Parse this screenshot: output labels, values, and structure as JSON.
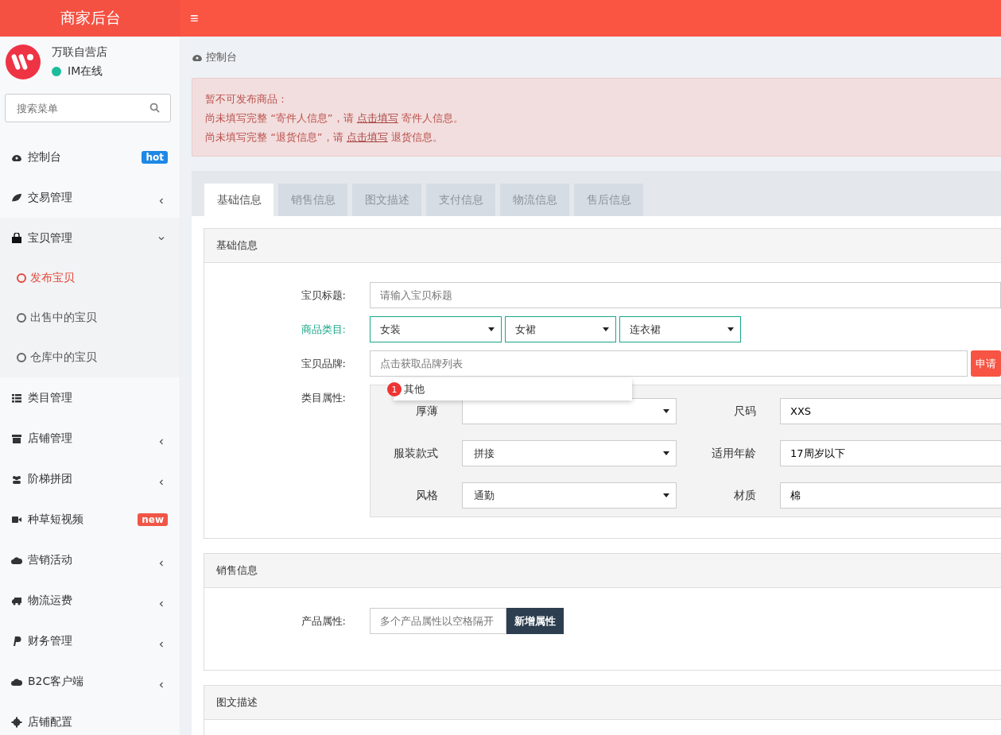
{
  "app": {
    "title": "商家后台",
    "menu_icon": "≡"
  },
  "sidebar": {
    "store_name": "万联自营店",
    "status": "IM在线",
    "search": {
      "placeholder": "搜索菜单"
    },
    "items": [
      {
        "label": "控制台",
        "badge": {
          "text": "hot",
          "color": "#1e88e5"
        },
        "expandable": false
      },
      {
        "label": "交易管理",
        "expandable": true,
        "expanded": false
      },
      {
        "label": "宝贝管理",
        "expandable": true,
        "expanded": true,
        "children": [
          {
            "label": "发布宝贝",
            "selected": true
          },
          {
            "label": "出售中的宝贝",
            "selected": false
          },
          {
            "label": "仓库中的宝贝",
            "selected": false
          }
        ]
      },
      {
        "label": "类目管理",
        "expandable": false
      },
      {
        "label": "店铺管理",
        "expandable": true,
        "expanded": false
      },
      {
        "label": "阶梯拼团",
        "expandable": true,
        "expanded": false
      },
      {
        "label": "种草短视频",
        "badge": {
          "text": "new",
          "color": "#f05545"
        },
        "expandable": false
      },
      {
        "label": "营销活动",
        "expandable": true,
        "expanded": false
      },
      {
        "label": "物流运费",
        "expandable": true,
        "expanded": false
      },
      {
        "label": "财务管理",
        "expandable": true,
        "expanded": false
      },
      {
        "label": "B2C客户端",
        "expandable": true,
        "expanded": false
      },
      {
        "label": "店铺配置",
        "expandable": false
      }
    ]
  },
  "breadcrumb": "控制台",
  "alert": {
    "title": "暂不可发布商品：",
    "lines": [
      {
        "before": "尚未填写完整 “寄件人信息”，请",
        "link": "点击填写",
        "after": "寄件人信息。"
      },
      {
        "before": "尚未填写完整 “退货信息”，请",
        "link": "点击填写",
        "after": "退货信息。"
      }
    ]
  },
  "tabs": [
    {
      "label": "基础信息",
      "selected": true
    },
    {
      "label": "销售信息",
      "selected": false
    },
    {
      "label": "图文描述",
      "selected": false
    },
    {
      "label": "支付信息",
      "selected": false
    },
    {
      "label": "物流信息",
      "selected": false
    },
    {
      "label": "售后信息",
      "selected": false
    }
  ],
  "basic": {
    "title": "基础信息",
    "item_title": {
      "label": "宝贝标题:",
      "placeholder": "请输入宝贝标题"
    },
    "category": {
      "label": "商品类目:",
      "valid": true,
      "selects": [
        "女装",
        "女裙",
        "连衣裙"
      ]
    },
    "brand": {
      "label": "宝贝品牌:",
      "placeholder": "点击获取品牌列表",
      "button": "申请",
      "suggestions": [
        {
          "badge": "1",
          "text": "其他"
        }
      ]
    },
    "attributes": {
      "label": "类目属性:",
      "items": [
        {
          "kind": "select",
          "label": "厚薄"
        },
        {
          "kind": "input",
          "label": "尺码",
          "value": "XXS"
        },
        {
          "kind": "select",
          "label": "服装款式",
          "value": "拼接"
        },
        {
          "kind": "input",
          "label": "适用年龄",
          "value": "17周岁以下"
        },
        {
          "kind": "select",
          "label": "风格",
          "value": "通勤"
        },
        {
          "kind": "input",
          "label": "材质",
          "value": "棉"
        }
      ]
    }
  },
  "sales": {
    "title": "销售信息",
    "label": "产品属性:",
    "placeholder": "多个产品属性以空格隔开",
    "button": "新增属性"
  },
  "description": {
    "title": "图文描述"
  }
}
